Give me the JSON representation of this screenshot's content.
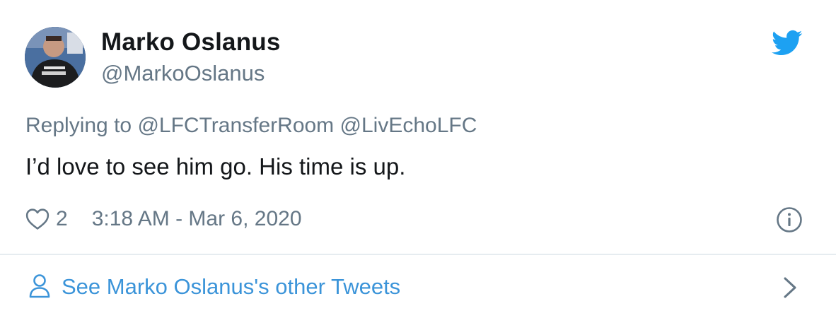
{
  "tweet": {
    "author": {
      "display_name": "Marko Oslanus",
      "handle": "@MarkoOslanus",
      "avatar_icon": "user-avatar-photo"
    },
    "brand_icon": "twitter-bird-icon",
    "replying_prefix": "Replying to",
    "replying_to": [
      "@LFCTransferRoom",
      "@LivEchoLFC"
    ],
    "text": "I’d love to see him go. His time is up.",
    "like_count": "2",
    "timestamp": "3:18 AM - Mar 6, 2020"
  },
  "footer": {
    "see_more_label": "See Marko Oslanus's other Tweets"
  },
  "colors": {
    "text_primary": "#14171a",
    "text_secondary": "#657786",
    "link": "#3b94d9",
    "twitter_blue": "#1da1f2",
    "divider": "#e6ecf0"
  }
}
